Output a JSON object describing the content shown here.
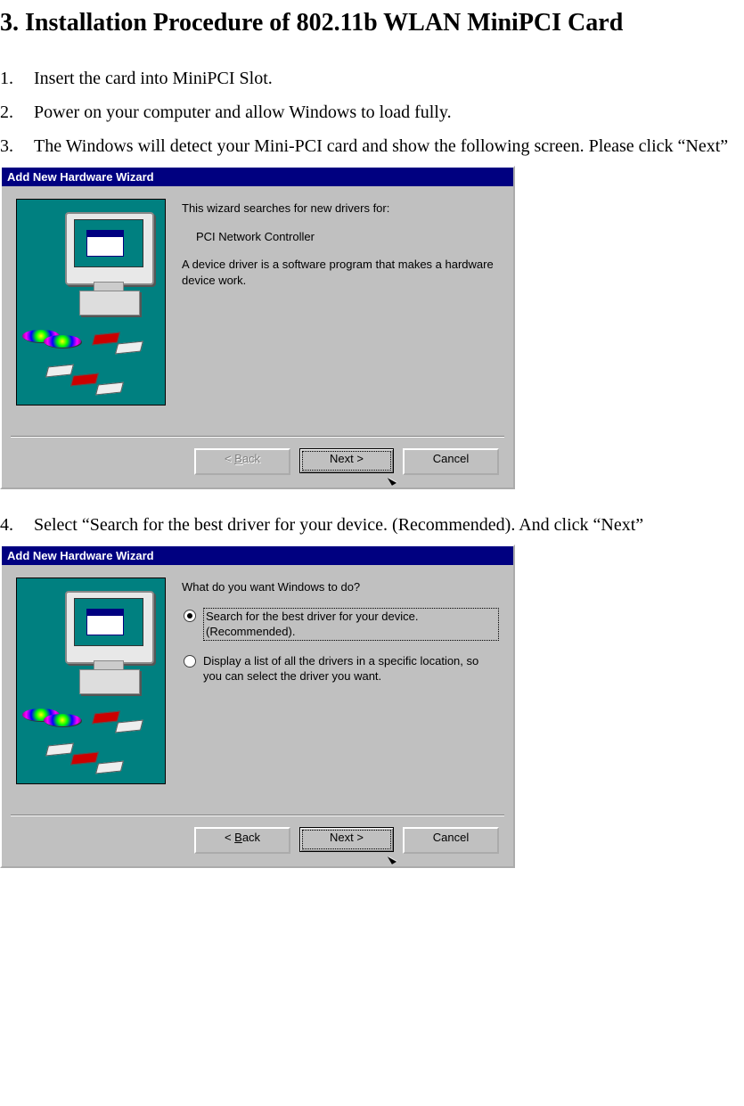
{
  "title": "3. Installation Procedure of 802.11b WLAN MiniPCI Card",
  "steps": {
    "s1": {
      "num": "1.",
      "text": "Insert the card into MiniPCI Slot."
    },
    "s2": {
      "num": "2.",
      "text": "Power on your computer and allow Windows to load fully."
    },
    "s3": {
      "num": "3.",
      "text": "The Windows will detect your Mini-PCI card and show the following screen. Please click “Next”"
    },
    "s4": {
      "num": "4.",
      "text": "Select “Search for the best driver for your device. (Recommended). And click “Next”"
    }
  },
  "wizard1": {
    "title": "Add New Hardware Wizard",
    "intro": "This wizard searches for new drivers for:",
    "device": "PCI Network Controller",
    "desc": "A device driver is a software program that makes a hardware device work.",
    "back": "< Back",
    "next": "Next >",
    "cancel": "Cancel"
  },
  "wizard2": {
    "title": "Add New Hardware Wizard",
    "question": "What do you want Windows to do?",
    "option1": "Search for the best driver for your device. (Recommended).",
    "option2": "Display a list of all the drivers in a specific location, so you can select the driver you want.",
    "back": "< Back",
    "next": "Next >",
    "cancel": "Cancel"
  }
}
